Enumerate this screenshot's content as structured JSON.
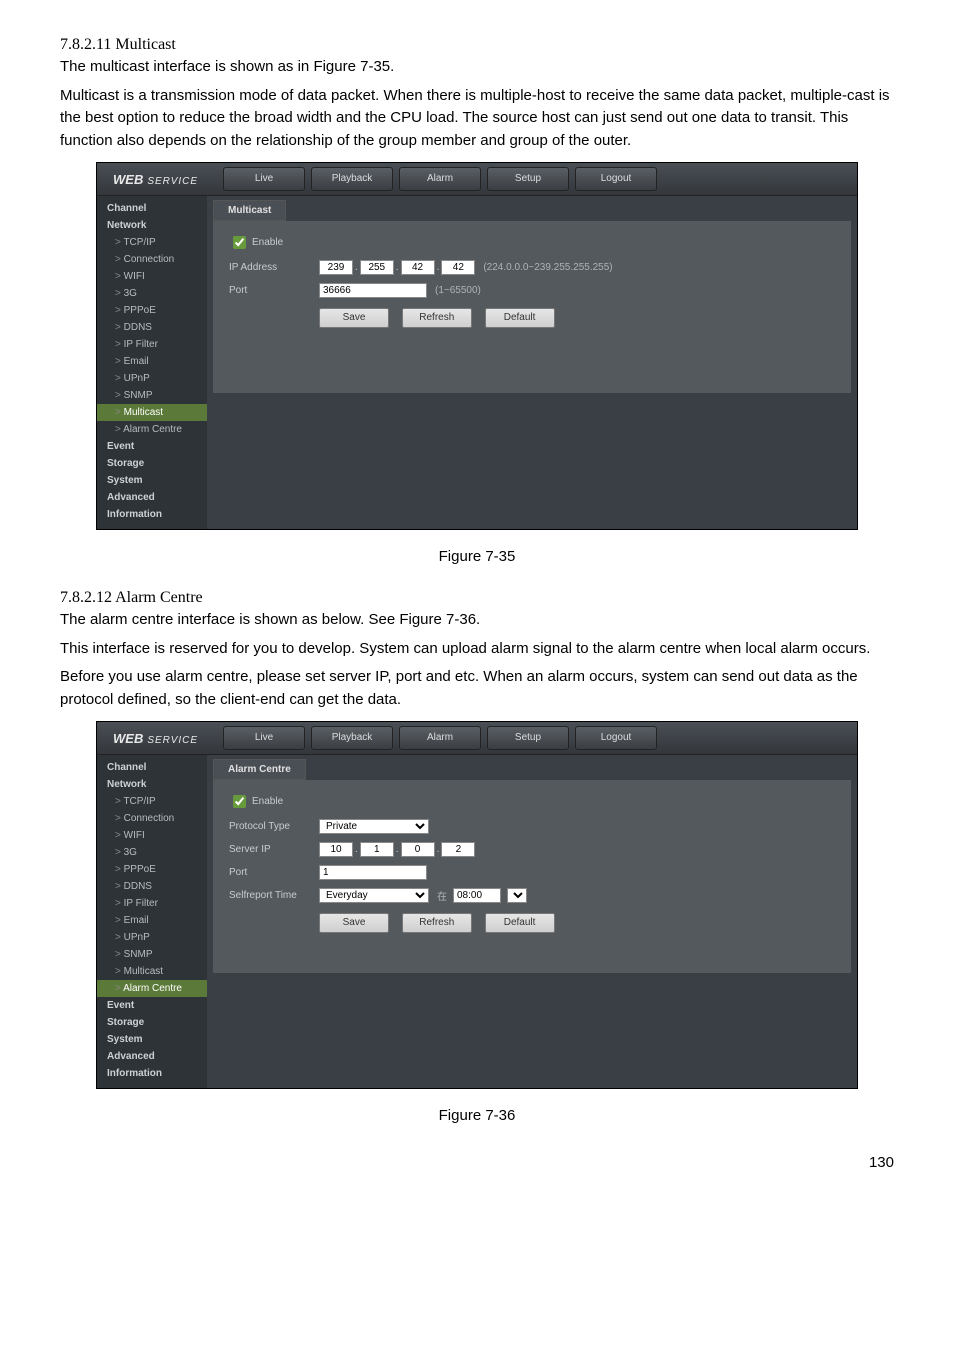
{
  "page_number": "130",
  "section1": {
    "heading": "7.8.2.11 Multicast",
    "p1": "The multicast interface is shown as in Figure 7-35.",
    "p2": "Multicast is a transmission mode of data packet. When there is multiple-host to receive the same data packet, multiple-cast is the best option to reduce the broad width and the CPU load.  The source host can just send out one data to transit. This function also depends on the relationship of the group member and group of the outer.",
    "caption": "Figure 7-35"
  },
  "section2": {
    "heading": "7.8.2.12 Alarm Centre",
    "p1": "The alarm centre interface is shown as below. See Figure 7-36.",
    "p2": "This interface is reserved for you to develop. System can upload alarm signal to the alarm centre when local alarm occurs.",
    "p3": "Before you use alarm centre, please set server IP, port and etc. When an alarm occurs, system can send out data as the protocol defined, so the client-end can get the data.",
    "caption": "Figure 7-36"
  },
  "ui": {
    "logo_main": "WEB",
    "logo_sub": "SERVICE",
    "tabs": [
      "Live",
      "Playback",
      "Alarm",
      "Setup",
      "Logout"
    ],
    "nav_top": [
      "Channel",
      "Network"
    ],
    "nav_network_children": [
      "TCP/IP",
      "Connection",
      "WIFI",
      "3G",
      "PPPoE",
      "DDNS",
      "IP Filter",
      "Email",
      "UPnP",
      "SNMP",
      "Multicast",
      "Alarm Centre"
    ],
    "nav_bottom": [
      "Event",
      "Storage",
      "System",
      "Advanced",
      "Information"
    ],
    "buttons": {
      "save": "Save",
      "refresh": "Refresh",
      "default": "Default"
    }
  },
  "multicast": {
    "panel_title": "Multicast",
    "enable_label": "Enable",
    "ip_label": "IP Address",
    "ip": [
      "239",
      "255",
      "42",
      "42"
    ],
    "ip_hint": "(224.0.0.0~239.255.255.255)",
    "port_label": "Port",
    "port": "36666",
    "port_hint": "(1~65500)"
  },
  "alarm": {
    "panel_title": "Alarm Centre",
    "enable_label": "Enable",
    "protocol_label": "Protocol Type",
    "protocol_value": "Private",
    "server_label": "Server IP",
    "server_ip": [
      "10",
      "1",
      "0",
      "2"
    ],
    "port_label": "Port",
    "port": "1",
    "selfreport_label": "Selfreport Time",
    "selfreport_value": "Everyday",
    "selfreport_at": "在",
    "selfreport_time": "08:00"
  }
}
